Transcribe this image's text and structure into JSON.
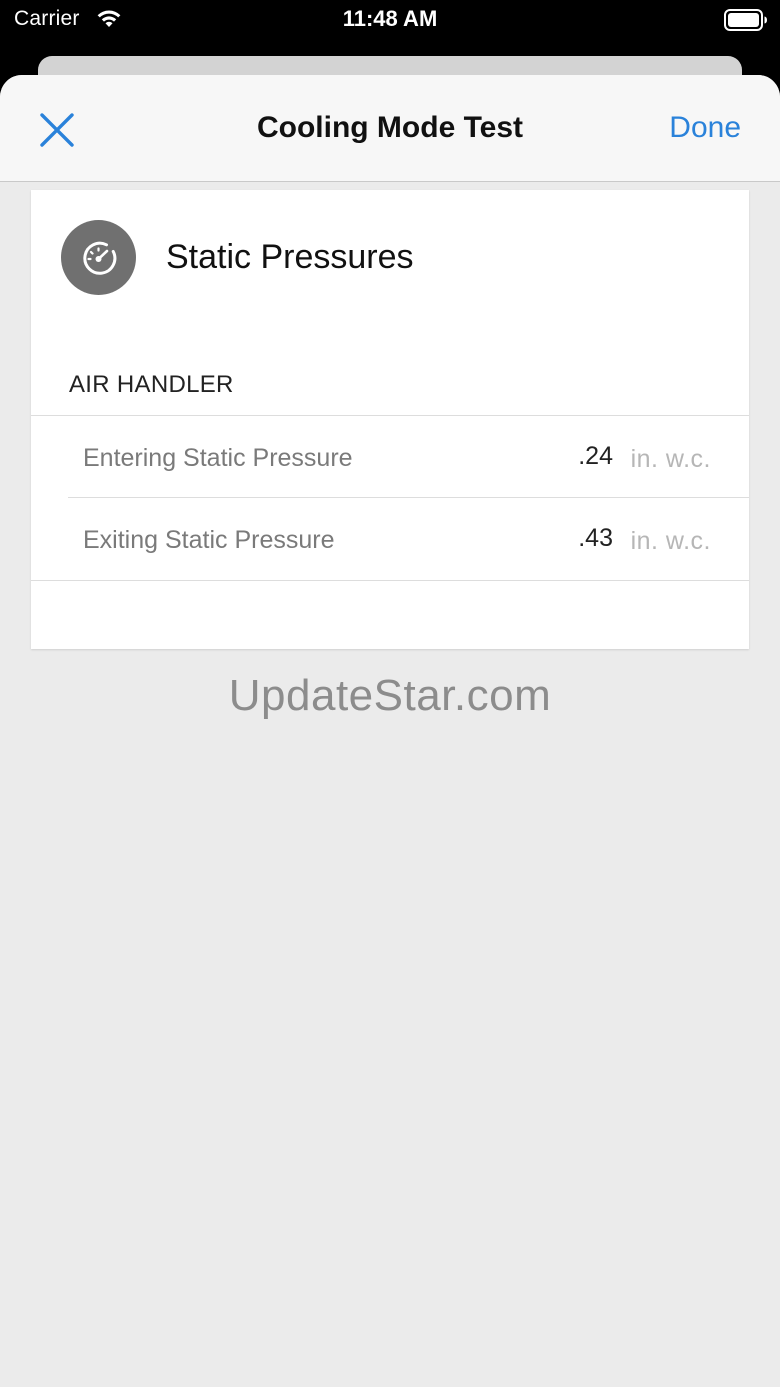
{
  "status_bar": {
    "carrier": "Carrier",
    "time": "11:48 AM",
    "wifi_icon": "wifi-icon",
    "battery_icon": "battery-icon"
  },
  "nav": {
    "title": "Cooling Mode Test",
    "close_icon": "close-icon",
    "done_label": "Done"
  },
  "card": {
    "icon": "gauge-icon",
    "title": "Static Pressures",
    "section_header": "AIR HANDLER",
    "rows": [
      {
        "label": "Entering Static Pressure",
        "value": ".24",
        "unit": "in. w.c."
      },
      {
        "label": "Exiting Static Pressure",
        "value": ".43",
        "unit": "in. w.c."
      }
    ]
  },
  "watermark": "UpdateStar.com",
  "colors": {
    "accent": "#2a82da",
    "background": "#ebebeb",
    "card": "#ffffff",
    "icon_circle": "#707070"
  }
}
